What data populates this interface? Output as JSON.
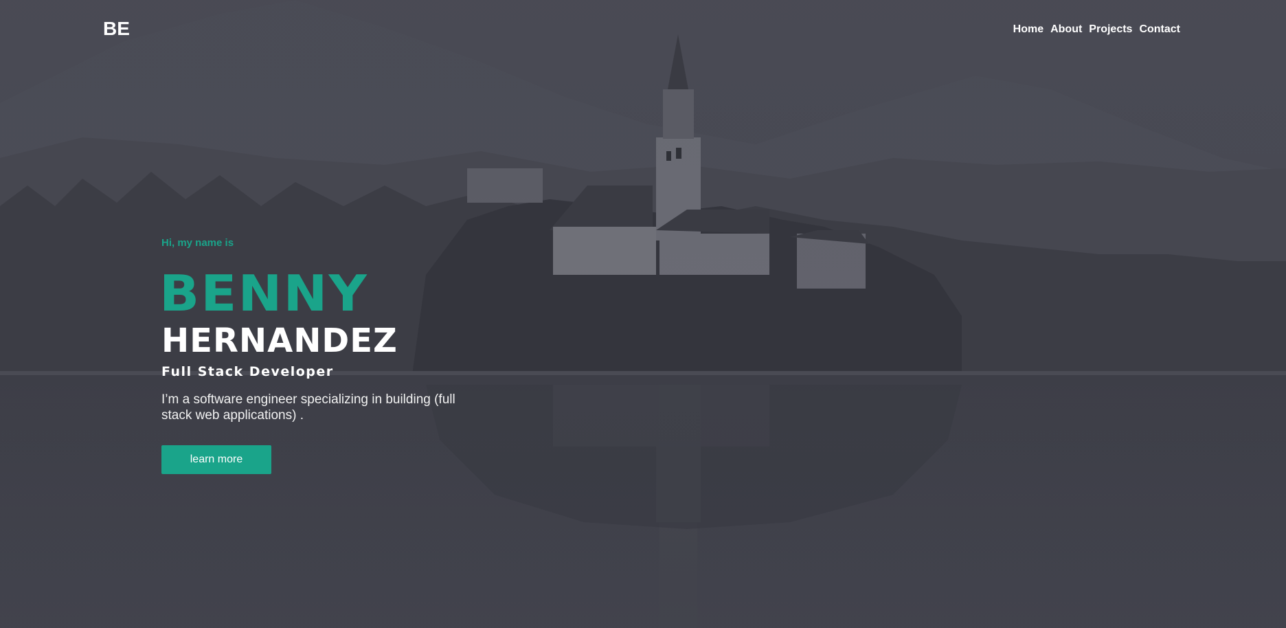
{
  "header": {
    "logo": "BE",
    "nav": [
      "Home",
      "About",
      "Projects",
      "Contact"
    ]
  },
  "hero": {
    "greeting": "Hi, my name is",
    "first_name": "BENNY",
    "last_name": "HERNANDEZ",
    "role": "Full Stack Developer",
    "description": "I’m a software engineer specializing in building (full stack web applications) .",
    "cta_label": "learn more"
  },
  "colors": {
    "accent": "#1aa48a",
    "background": "#3f4049",
    "text": "#ffffff"
  }
}
